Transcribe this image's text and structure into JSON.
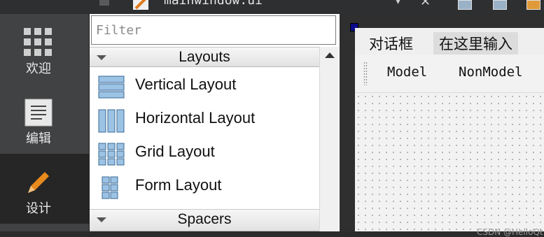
{
  "topbar": {
    "file_title": "mainwindow.ui",
    "icons": [
      "small-doc-icon",
      "edit-icon",
      "chevron-down-icon",
      "close-icon",
      "toolbar-icon-1",
      "toolbar-icon-2",
      "toolbar-icon-3"
    ]
  },
  "modes": [
    {
      "label": "欢迎",
      "icon": "grid-icon"
    },
    {
      "label": "编辑",
      "icon": "document-icon"
    },
    {
      "label": "设计",
      "icon": "pencil-icon",
      "active": true
    }
  ],
  "widgetbox": {
    "filter_placeholder": "Filter",
    "categories": [
      {
        "label": "Layouts",
        "items": [
          {
            "label": "Vertical Layout",
            "icon": "vertical-layout-icon"
          },
          {
            "label": "Horizontal Layout",
            "icon": "horizontal-layout-icon"
          },
          {
            "label": "Grid Layout",
            "icon": "grid-layout-icon"
          },
          {
            "label": "Form Layout",
            "icon": "form-layout-icon"
          }
        ]
      },
      {
        "label": "Spacers",
        "items": []
      }
    ]
  },
  "form": {
    "menus": [
      "对话框",
      "在这里输入"
    ],
    "toolbar_buttons": [
      "Model",
      "NonModel"
    ]
  },
  "watermark": "CSDN @HelloQt"
}
